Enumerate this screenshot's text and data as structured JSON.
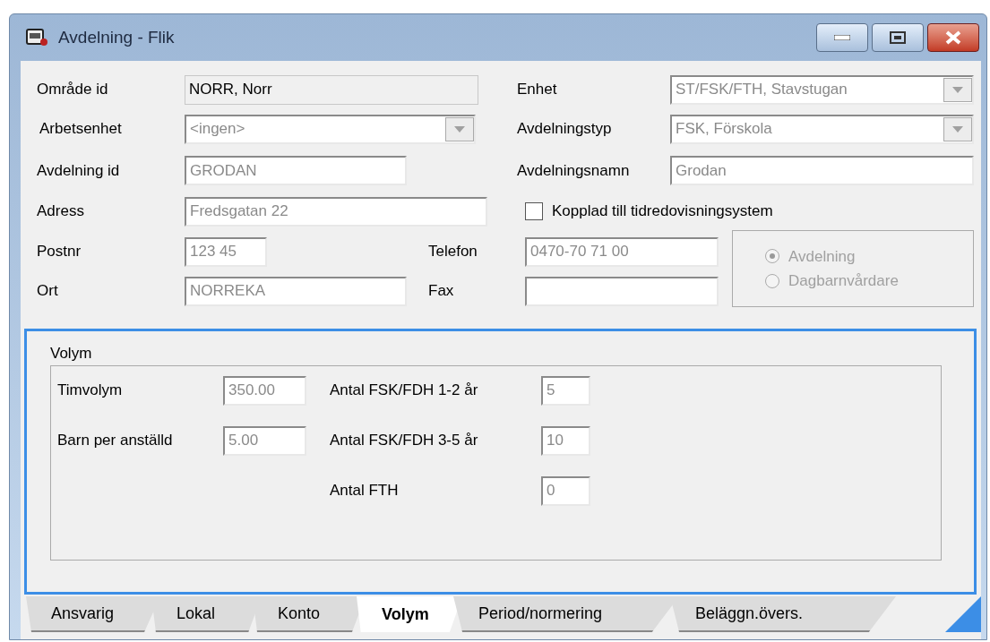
{
  "window": {
    "title": "Avdelning - Flik"
  },
  "omrade_id": {
    "label": "Område id",
    "value": "NORR, Norr"
  },
  "enhet": {
    "label": "Enhet",
    "value": "ST/FSK/FTH, Stavstugan"
  },
  "arbetsenhet": {
    "label": "Arbetsenhet",
    "value": "<ingen>"
  },
  "avdelningstyp": {
    "label": "Avdelningstyp",
    "value": "FSK, Förskola"
  },
  "avdelning_id": {
    "label": "Avdelning id",
    "value": "GRODAN"
  },
  "avdelningsnamn": {
    "label": "Avdelningsnamn",
    "value": "Grodan"
  },
  "adress": {
    "label": "Adress",
    "value": "Fredsgatan 22"
  },
  "kopplad": {
    "label": "Kopplad till tidredovisningsystem",
    "checked": false
  },
  "postnr": {
    "label": "Postnr",
    "value": "123 45"
  },
  "telefon": {
    "label": "Telefon",
    "value": "0470-70 71 00"
  },
  "ort": {
    "label": "Ort",
    "value": "NORREKA"
  },
  "fax": {
    "label": "Fax"
  },
  "typ_radio": {
    "disabled": true,
    "options": [
      {
        "label": "Avdelning",
        "selected": true
      },
      {
        "label": "Dagbarnvårdare",
        "selected": false
      }
    ]
  },
  "volym": {
    "title": "Volym",
    "timvolym": {
      "label": "Timvolym",
      "value": "350.00"
    },
    "barn_per_anstalld": {
      "label": "Barn per anställd",
      "value": "5.00"
    },
    "antal": [
      {
        "label": "Antal FSK/FDH 1-2 år",
        "value": "5"
      },
      {
        "label": "Antal FSK/FDH 3-5 år",
        "value": "10"
      },
      {
        "label": "Antal FTH",
        "value": "0"
      }
    ]
  },
  "tabs": [
    {
      "label": "Ansvarig",
      "selected": false
    },
    {
      "label": "Lokal",
      "selected": false
    },
    {
      "label": "Konto",
      "selected": false
    },
    {
      "label": "Volym",
      "selected": true
    },
    {
      "label": "Period/normering",
      "selected": false
    },
    {
      "label": "Beläggn.övers.",
      "selected": false
    }
  ]
}
